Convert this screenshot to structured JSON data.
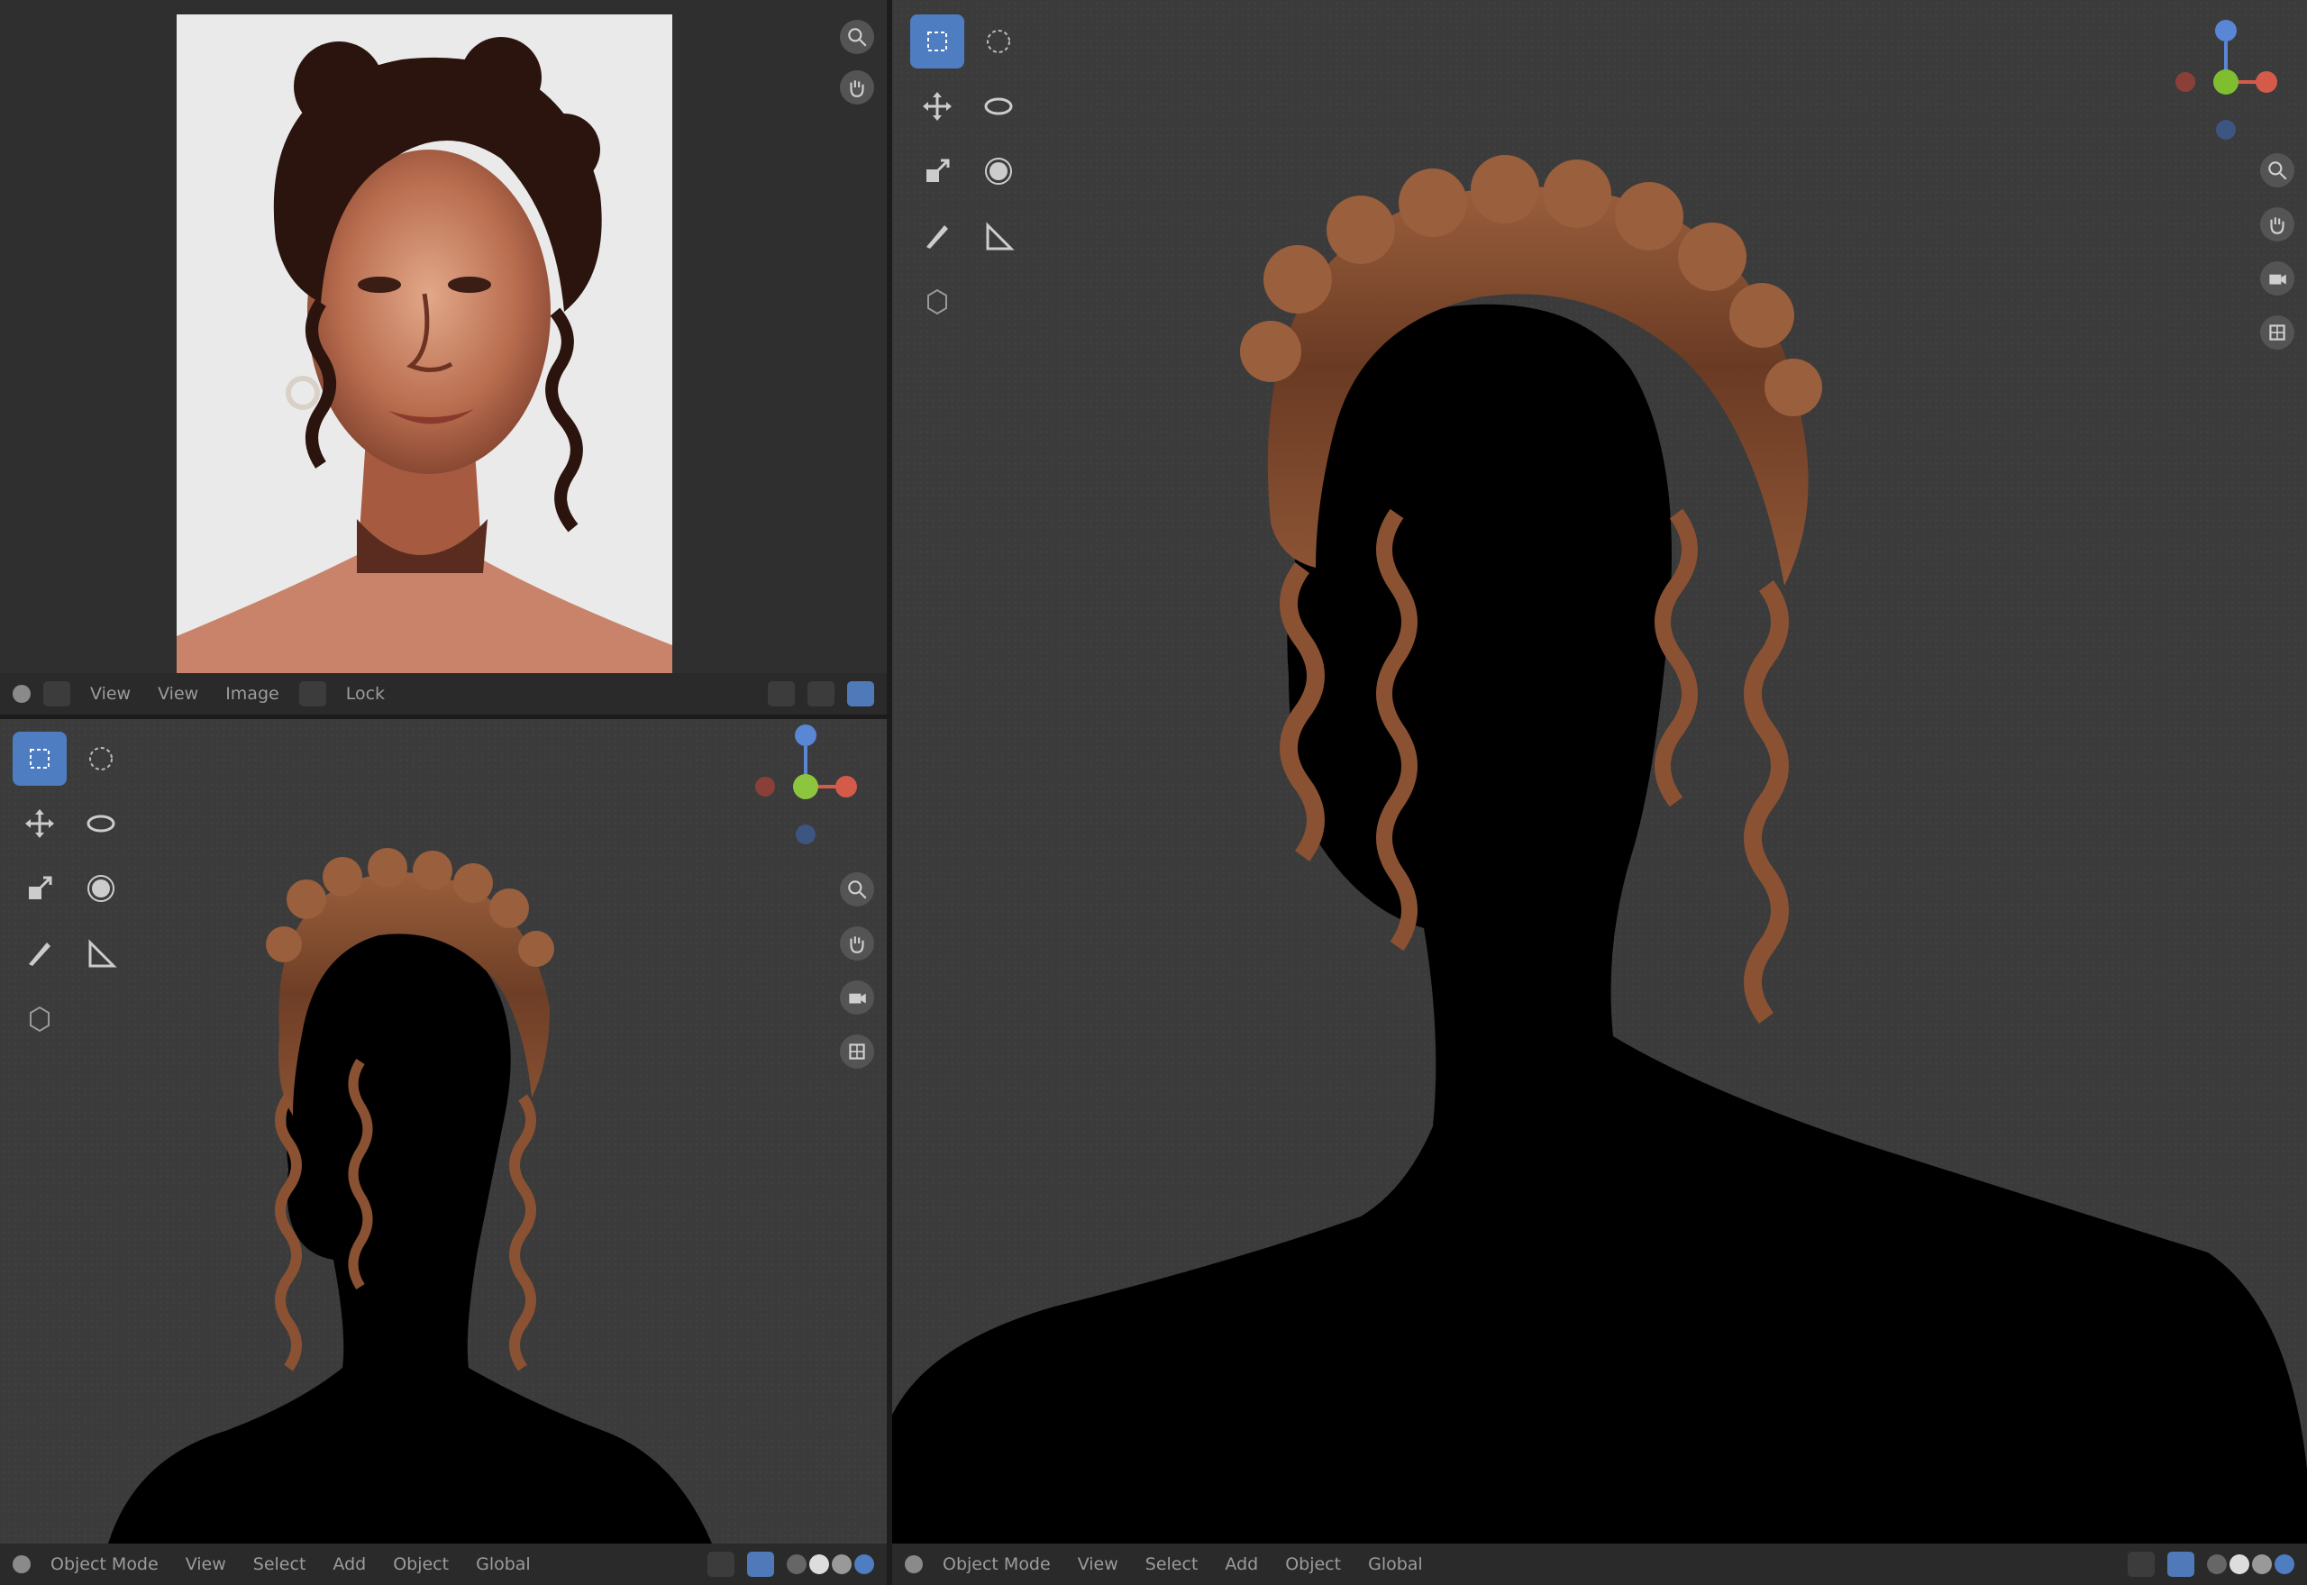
{
  "image_editor": {
    "header": {
      "view_menu": "View",
      "image_menu": "Image",
      "mode_label": "View",
      "slot_label": "Lock"
    },
    "image": {
      "content": "reference portrait"
    }
  },
  "viewport_small": {
    "header": {
      "mode_label": "Object Mode",
      "view_menu": "View",
      "select_menu": "Select",
      "add_menu": "Add",
      "object_menu": "Object",
      "transform_label": "Global"
    }
  },
  "viewport_large": {
    "header": {
      "mode_label": "Object Mode",
      "view_menu": "View",
      "select_menu": "Select",
      "add_menu": "Add",
      "object_menu": "Object",
      "transform_label": "Global"
    }
  },
  "tools": [
    "select-box",
    "select-circle",
    "move",
    "rotate",
    "scale",
    "transform",
    "annotate",
    "measure",
    "add-cube"
  ],
  "colors": {
    "accent": "#4f7dc1",
    "viewport_bg": "#3b3b3b",
    "header_bg": "#2a2a2a",
    "hair": "#8a5233",
    "silhouette": "#000000",
    "gizmo_z": "#5a86d6",
    "gizmo_x": "#d45a4a",
    "gizmo_y": "#7fbf2f"
  }
}
